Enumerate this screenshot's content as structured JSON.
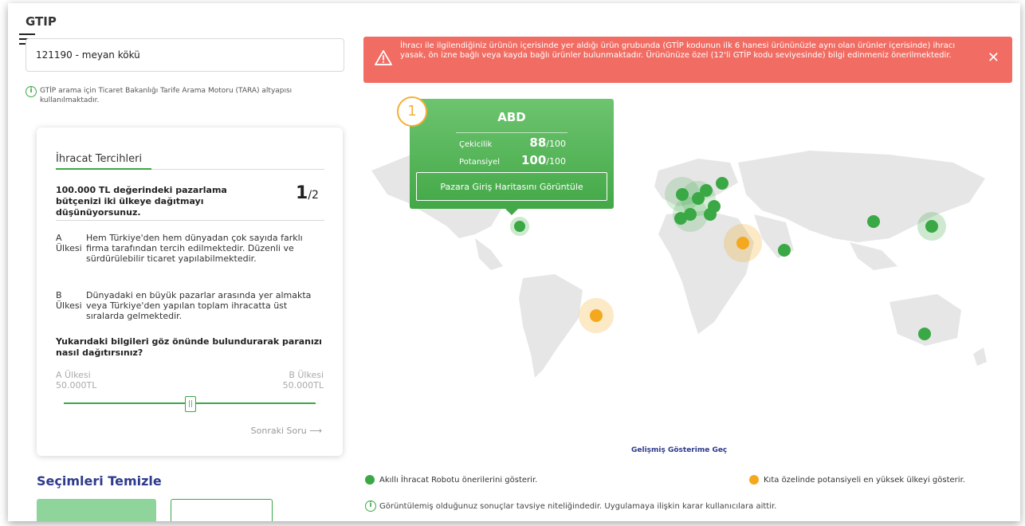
{
  "header": {
    "title": "GTIP"
  },
  "search": {
    "value": "121190 - meyan kökü"
  },
  "note": "GTİP arama için Ticaret Bakanlığı Tarife Arama Motoru (TARA) altyapısı kullanılmaktadır.",
  "card": {
    "title": "İhracat Tercihleri",
    "question_intro": "100.000 TL değerindeki pazarlama bütçenizi iki ülkeye dağıtmayı düşünüyorsunuz.",
    "step_current": "1",
    "step_total": "/2",
    "option_a_label": "A Ülkesi",
    "option_a_text": "Hem Türkiye'den hem dünyadan çok sayıda farklı firma tarafından tercih edilmektedir. Düzenli ve sürdürülebilir ticaret yapılabilmektedir.",
    "option_b_label": "B Ülkesi",
    "option_b_text": "Dünyadaki en büyük pazarlar arasında yer almakta veya Türkiye'den yapılan toplam ihracatta üst sıralarda gelmektedir.",
    "question": "Yukarıdaki bilgileri göz önünde bulundurarak paranızı nasıl dağıtırsınız?",
    "slider_left_label": "A Ülkesi",
    "slider_left_value": "50.000TL",
    "slider_right_label": "B Ülkesi",
    "slider_right_value": "50.000TL",
    "slider_value_fraction": 0.5,
    "next_label": "Sonraki Soru ⟶"
  },
  "clear_label": "Seçimleri Temizle",
  "alert": {
    "text": "İhracı ile ilgilendiğiniz ürünün içerisinde yer aldığı ürün grubunda (GTİP kodunun ilk 6 hanesi ürününüzle aynı olan ürünler içerisinde) ihracı yasak, ön izne bağlı veya kayda bağlı ürünler bulunmaktadır. Ürününüze özel (12'li GTİP kodu seviyesinde) bilgi edinmeniz önerilmektedir.",
    "color": "#f16d63"
  },
  "tooltip": {
    "badge": "1",
    "country": "ABD",
    "attractiveness_label": "Çekicilik",
    "attractiveness_value": "88",
    "potential_label": "Potansiyel",
    "potential_value": "100",
    "out_of": "/100",
    "button_label": "Pazara Giriş Haritasını Görüntüle"
  },
  "advanced_link": "Gelişmiş Gösterime Geç",
  "legend": {
    "green_text": "Akıllı İhracat Robotu önerilerini gösterir.",
    "orange_text": "Kıta özelinde potansiyeli en yüksek ülkeyi gösterir.",
    "green_color": "#3aa845",
    "orange_color": "#f4a81d"
  },
  "disclaimer": "Görüntülemiş olduğunuz sonuçlar tavsiye niteliğindedir. Uygulamaya ilişkin karar kullanıcılara aittir."
}
